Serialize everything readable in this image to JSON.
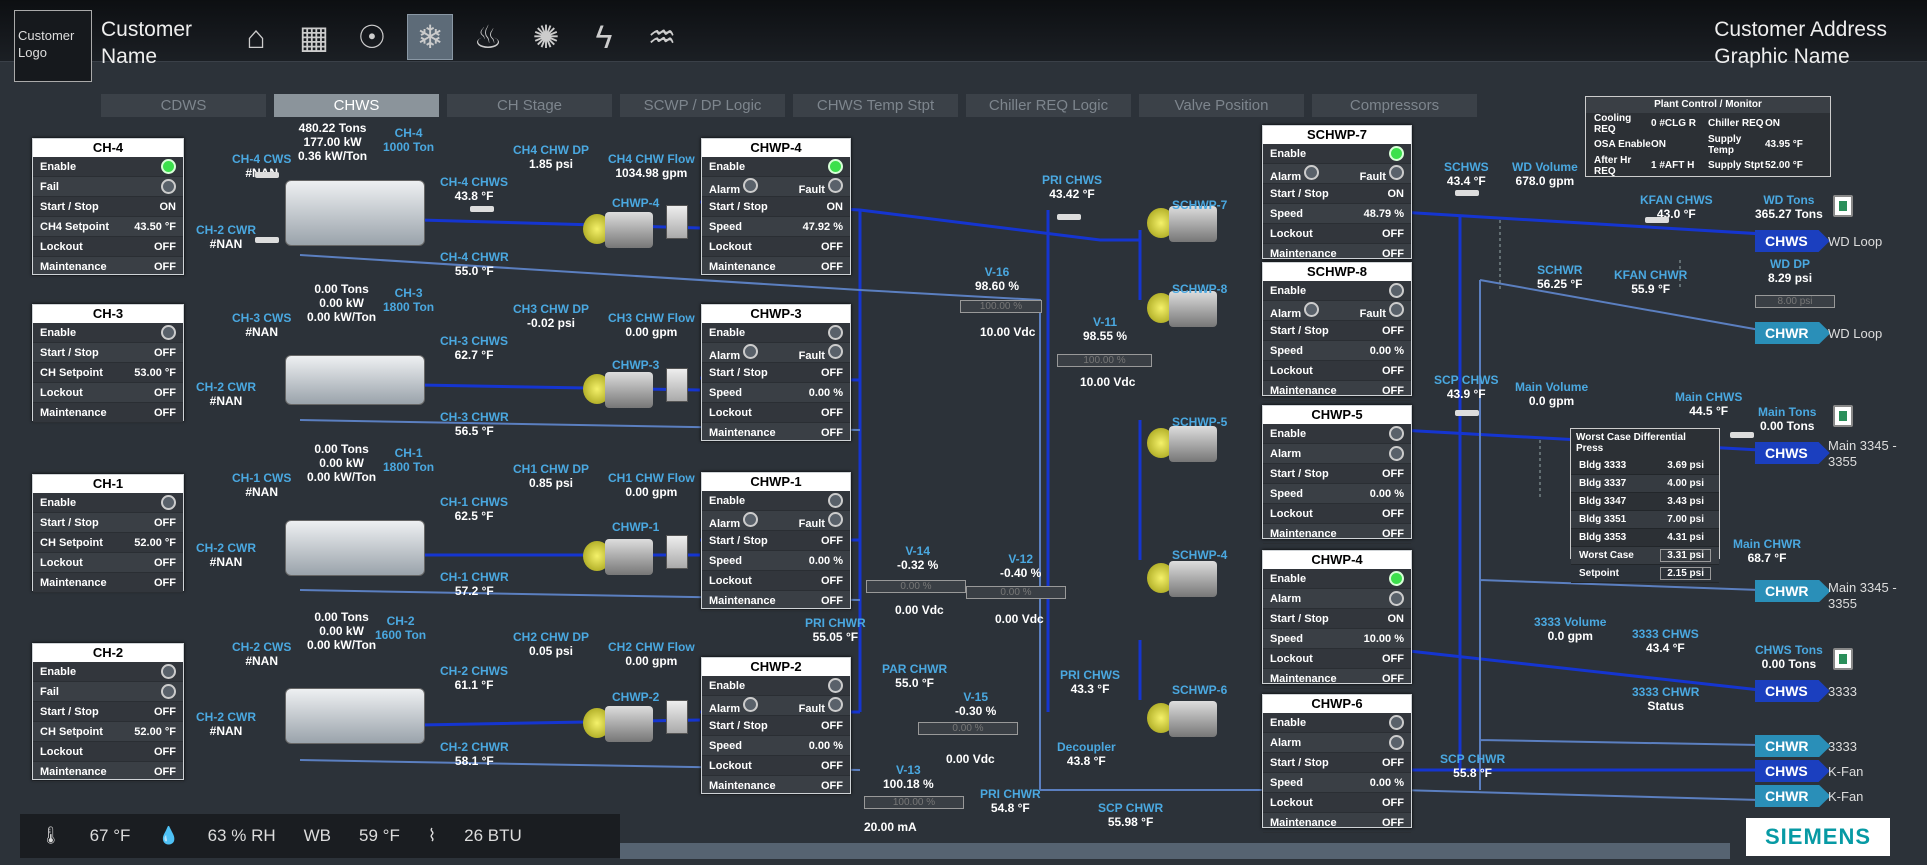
{
  "header": {
    "logo": "Customer Logo",
    "customer_name": "Customer Name",
    "customer_address": "Customer Address",
    "graphic_name": "Graphic Name",
    "icons": [
      "home-icon",
      "trend-icon",
      "fan-icon",
      "snowflake-icon",
      "heat-icon",
      "lightbulb-icon",
      "electric-icon",
      "water-icon"
    ]
  },
  "tabs": [
    "CDWS",
    "CHWS",
    "CH Stage",
    "SCWP / DP Logic",
    "CHWS Temp Stpt",
    "Chiller REQ Logic",
    "Valve Position",
    "Compressors"
  ],
  "active_tab": "CHWS",
  "plant": {
    "title": "Plant Control / Monitor",
    "rows": [
      [
        "Cooling REQ",
        "0 #CLG R",
        "Chiller REQ",
        "ON"
      ],
      [
        "OSA Enable",
        "ON",
        "Supply Temp",
        "43.95 °F"
      ],
      [
        "After Hr REQ",
        "1 #AFT H",
        "Supply Stpt",
        "52.00 °F"
      ]
    ]
  },
  "chillers": {
    "ch4": {
      "title": "CH-4",
      "rows": [
        [
          "Enable",
          "led-on"
        ],
        [
          "Fail",
          "led"
        ],
        [
          "Start / Stop",
          "ON"
        ],
        [
          "CH4 Setpoint",
          "43.50 °F"
        ],
        [
          "Lockout",
          "OFF"
        ],
        [
          "Maintenance",
          "OFF"
        ]
      ],
      "tons": "480.22 Tons",
      "kw": "177.00 kW",
      "kwton": "0.36 kW/Ton",
      "name": "CH-4",
      "size": "1000 Ton",
      "cws_lbl": "CH-4 CWS",
      "cws": "#NAN",
      "cwr_lbl": "CH-2 CWR",
      "cwr": "#NAN",
      "chws_lbl": "CH-4 CHWS",
      "chws": "43.8 °F",
      "chwr_lbl": "CH-4 CHWR",
      "chwr": "55.0 °F",
      "dp_lbl": "CH4 CHW DP",
      "dp": "1.85 psi",
      "flow_lbl": "CH4 CHW Flow",
      "flow": "1034.98 gpm"
    },
    "ch3": {
      "title": "CH-3",
      "rows": [
        [
          "Enable",
          "led"
        ],
        [
          "Start / Stop",
          "OFF"
        ],
        [
          "CH Setpoint",
          "53.00 °F"
        ],
        [
          "Lockout",
          "OFF"
        ],
        [
          "Maintenance",
          "OFF"
        ]
      ],
      "tons": "0.00 Tons",
      "kw": "0.00 kW",
      "kwton": "0.00 kW/Ton",
      "name": "CH-3",
      "size": "1800 Ton",
      "cws_lbl": "CH-3 CWS",
      "cws": "#NAN",
      "cwr_lbl": "CH-2 CWR",
      "cwr": "#NAN",
      "chws_lbl": "CH-3 CHWS",
      "chws": "62.7 °F",
      "chwr_lbl": "CH-3 CHWR",
      "chwr": "56.5 °F",
      "dp_lbl": "CH3 CHW DP",
      "dp": "-0.02 psi",
      "flow_lbl": "CH3 CHW Flow",
      "flow": "0.00 gpm"
    },
    "ch1": {
      "title": "CH-1",
      "rows": [
        [
          "Enable",
          "led"
        ],
        [
          "Start / Stop",
          "OFF"
        ],
        [
          "CH Setpoint",
          "52.00 °F"
        ],
        [
          "Lockout",
          "OFF"
        ],
        [
          "Maintenance",
          "OFF"
        ]
      ],
      "tons": "0.00 Tons",
      "kw": "0.00 kW",
      "kwton": "0.00 kW/Ton",
      "name": "CH-1",
      "size": "1800 Ton",
      "cws_lbl": "CH-1 CWS",
      "cws": "#NAN",
      "cwr_lbl": "CH-2 CWR",
      "cwr": "#NAN",
      "chws_lbl": "CH-1 CHWS",
      "chws": "62.5 °F",
      "chwr_lbl": "CH-1 CHWR",
      "chwr": "57.2 °F",
      "dp_lbl": "CH1 CHW DP",
      "dp": "0.85 psi",
      "flow_lbl": "CH1 CHW Flow",
      "flow": "0.00 gpm"
    },
    "ch2": {
      "title": "CH-2",
      "rows": [
        [
          "Enable",
          "led"
        ],
        [
          "Fail",
          "led"
        ],
        [
          "Start / Stop",
          "OFF"
        ],
        [
          "CH Setpoint",
          "52.00 °F"
        ],
        [
          "Lockout",
          "OFF"
        ],
        [
          "Maintenance",
          "OFF"
        ]
      ],
      "tons": "0.00 Tons",
      "kw": "0.00 kW",
      "kwton": "0.00 kW/Ton",
      "name": "CH-2",
      "size": "1600 Ton",
      "cws_lbl": "CH-2 CWS",
      "cws": "#NAN",
      "cwr_lbl": "CH-2 CWR",
      "cwr": "#NAN",
      "chws_lbl": "CH-2 CHWS",
      "chws": "61.1 °F",
      "chwr_lbl": "CH-2 CHWR",
      "chwr": "58.1 °F",
      "dp_lbl": "CH2 CHW DP",
      "dp": "0.05 psi",
      "flow_lbl": "CH2 CHW Flow",
      "flow": "0.00 gpm"
    }
  },
  "chwp": {
    "p4": {
      "title": "CHWP-4",
      "name": "CHWP-4",
      "start": "ON",
      "speed": "47.92 %",
      "lockout": "OFF",
      "maint": "OFF"
    },
    "p3": {
      "title": "CHWP-3",
      "name": "CHWP-3",
      "start": "OFF",
      "speed": "0.00 %",
      "lockout": "OFF",
      "maint": "OFF"
    },
    "p1": {
      "title": "CHWP-1",
      "name": "CHWP-1",
      "start": "OFF",
      "speed": "0.00 %",
      "lockout": "OFF",
      "maint": "OFF"
    },
    "p2": {
      "title": "CHWP-2",
      "name": "CHWP-2",
      "start": "OFF",
      "speed": "0.00 %",
      "lockout": "OFF",
      "maint": "OFF"
    }
  },
  "schwp": {
    "s7": {
      "title": "SCHWP-7",
      "name": "SCHWP-7",
      "start": "ON",
      "speed": "48.79 %",
      "lockout": "OFF",
      "maint": "OFF"
    },
    "s8": {
      "title": "SCHWP-8",
      "name": "SCHWP-8",
      "start": "OFF",
      "speed": "0.00 %",
      "lockout": "OFF",
      "maint": "OFF"
    },
    "s5": {
      "title": "CHWP-5",
      "name": "SCHWP-5",
      "start": "OFF",
      "speed": "0.00 %",
      "lockout": "OFF",
      "maint": "OFF"
    },
    "s4": {
      "title": "CHWP-4",
      "name": "SCHWP-4",
      "start": "ON",
      "speed": "10.00 %",
      "lockout": "OFF",
      "maint": "OFF"
    },
    "s6": {
      "title": "CHWP-6",
      "name": "SCHWP-6",
      "start": "OFF",
      "speed": "0.00 %",
      "lockout": "OFF",
      "maint": "OFF"
    }
  },
  "labels": {
    "enable": "Enable",
    "fail": "Fail",
    "alarm": "Alarm",
    "fault": "Fault",
    "start_stop": "Start / Stop",
    "speed": "Speed",
    "lockout": "Lockout",
    "maintenance": "Maintenance"
  },
  "valves": {
    "v16": {
      "name": "V-16",
      "pos": "98.60 %",
      "bar": "100.00 %",
      "out": "10.00 Vdc"
    },
    "v11": {
      "name": "V-11",
      "pos": "98.55 %",
      "bar": "100.00 %",
      "out": "10.00 Vdc"
    },
    "v14": {
      "name": "V-14",
      "pos": "-0.32 %",
      "bar": "0.00 %",
      "out": "0.00 Vdc"
    },
    "v12": {
      "name": "V-12",
      "pos": "-0.40 %",
      "bar": "0.00 %",
      "out": "0.00 Vdc"
    },
    "v15": {
      "name": "V-15",
      "pos": "-0.30 %",
      "bar": "0.00 %",
      "out": "0.00 Vdc"
    },
    "v13": {
      "name": "V-13",
      "pos": "100.18 %",
      "bar": "100.00 %",
      "out": "20.00 mA"
    }
  },
  "points": {
    "pri_chws_top_lbl": "PRI CHWS",
    "pri_chws_top": "43.42 °F",
    "pri_chwr_lbl": "PRI CHWR",
    "pri_chwr": "55.05 °F",
    "par_chwr_lbl": "PAR CHWR",
    "par_chwr": "55.0 °F",
    "pri_chws_lbl": "PRI CHWS",
    "pri_chws": "43.3 °F",
    "decoupler_lbl": "Decoupler",
    "decoupler": "43.8 °F",
    "pri_chwr_bot_lbl": "PRI CHWR",
    "pri_chwr_bot": "54.8 °F",
    "scp_chwr_lbl": "SCP CHWR",
    "scp_chwr": "55.98 °F",
    "schws_lbl": "SCHWS",
    "schws": "43.4 °F",
    "wd_vol_lbl": "WD Volume",
    "wd_vol": "678.0 gpm",
    "kfan_chws_lbl": "KFAN CHWS",
    "kfan_chws": "43.0 °F",
    "wd_tons_lbl": "WD Tons",
    "wd_tons": "365.27 Tons",
    "schwr_lbl": "SCHWR",
    "schwr": "56.25 °F",
    "kfan_chwr_lbl": "KFAN CHWR",
    "kfan_chwr": "55.9 °F",
    "wd_dp_lbl": "WD DP",
    "wd_dp": "8.29 psi",
    "wd_dp_bar": "8.00 psi",
    "scp_chws_lbl": "SCP CHWS",
    "scp_chws": "43.9 °F",
    "main_vol_lbl": "Main Volume",
    "main_vol": "0.0 gpm",
    "main_chws_lbl": "Main CHWS",
    "main_chws": "44.5 °F",
    "main_tons_lbl": "Main Tons",
    "main_tons": "0.00 Tons",
    "main_chwr_lbl": "Main CHWR",
    "main_chwr": "68.7 °F",
    "v3333_vol_lbl": "3333 Volume",
    "v3333_vol": "0.0 gpm",
    "c3333_chws_lbl": "3333 CHWS",
    "c3333_chws": "43.4 °F",
    "chws_tons_lbl": "CHWS Tons",
    "chws_tons": "0.00 Tons",
    "c3333_chwr_lbl": "3333 CHWR",
    "c3333_chwr": "Status",
    "scp_chwr2_lbl": "SCP CHWR",
    "scp_chwr2": "55.8 °F"
  },
  "wcdp": {
    "title": "Worst Case Differential Press",
    "rows": [
      [
        "Bldg 3333",
        "3.69 psi"
      ],
      [
        "Bldg 3337",
        "4.00 psi"
      ],
      [
        "Bldg 3347",
        "3.43 psi"
      ],
      [
        "Bldg 3351",
        "7.00 psi"
      ],
      [
        "Bldg 3353",
        "4.31 psi"
      ],
      [
        "Worst Case",
        "3.31 psi"
      ],
      [
        "Setpoint",
        "2.15 psi"
      ]
    ]
  },
  "tags": [
    {
      "type": "CHWS",
      "dest": "WD Loop"
    },
    {
      "type": "CHWR",
      "dest": "WD Loop"
    },
    {
      "type": "CHWS",
      "dest": "Main 3345 - 3355"
    },
    {
      "type": "CHWR",
      "dest": "Main 3345 - 3355"
    },
    {
      "type": "CHWS",
      "dest": "3333"
    },
    {
      "type": "CHWR",
      "dest": "3333"
    },
    {
      "type": "CHWS",
      "dest": "K-Fan"
    },
    {
      "type": "CHWR",
      "dest": "K-Fan"
    }
  ],
  "weather": {
    "temp": "67 °F",
    "rh": "63 % RH",
    "wb_label": "WB",
    "wb": "59 °F",
    "btu": "26 BTU"
  },
  "brand": "SIEMENS"
}
